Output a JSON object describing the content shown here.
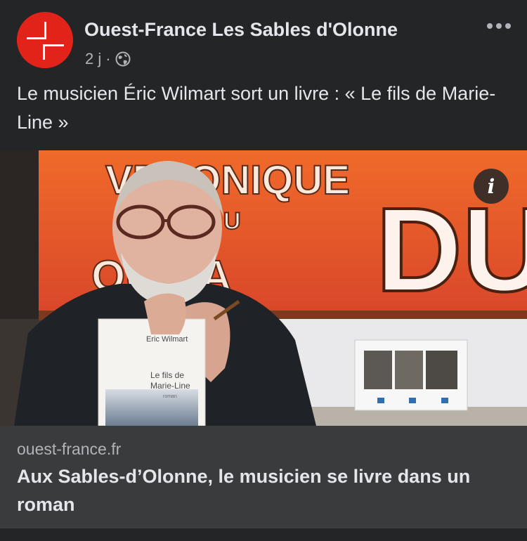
{
  "post": {
    "page_name": "Ouest-France Les Sables d'Olonne",
    "time": "2 j",
    "separator": "·",
    "audience_icon": "globe-icon",
    "more_icon": "more-options-icon",
    "text": "Le musicien Éric Wilmart sort un livre : « Le fils de Marie-Line »"
  },
  "photo": {
    "sign_text": [
      "VERONIQUE",
      "U",
      "QUINA",
      "DU"
    ],
    "book_author": "Eric Wilmart",
    "book_title": [
      "Le fils de",
      "Marie-Line"
    ],
    "book_subtitle": "roman",
    "info_label": "i"
  },
  "link": {
    "domain": "ouest-france.fr",
    "title": "Aux Sables-d’Olonne, le musicien se livre dans un roman"
  },
  "colors": {
    "background": "#242526",
    "card": "#3a3b3c",
    "brand_red": "#e2231a",
    "text_primary": "#e4e6eb",
    "text_secondary": "#b0b3b8"
  }
}
